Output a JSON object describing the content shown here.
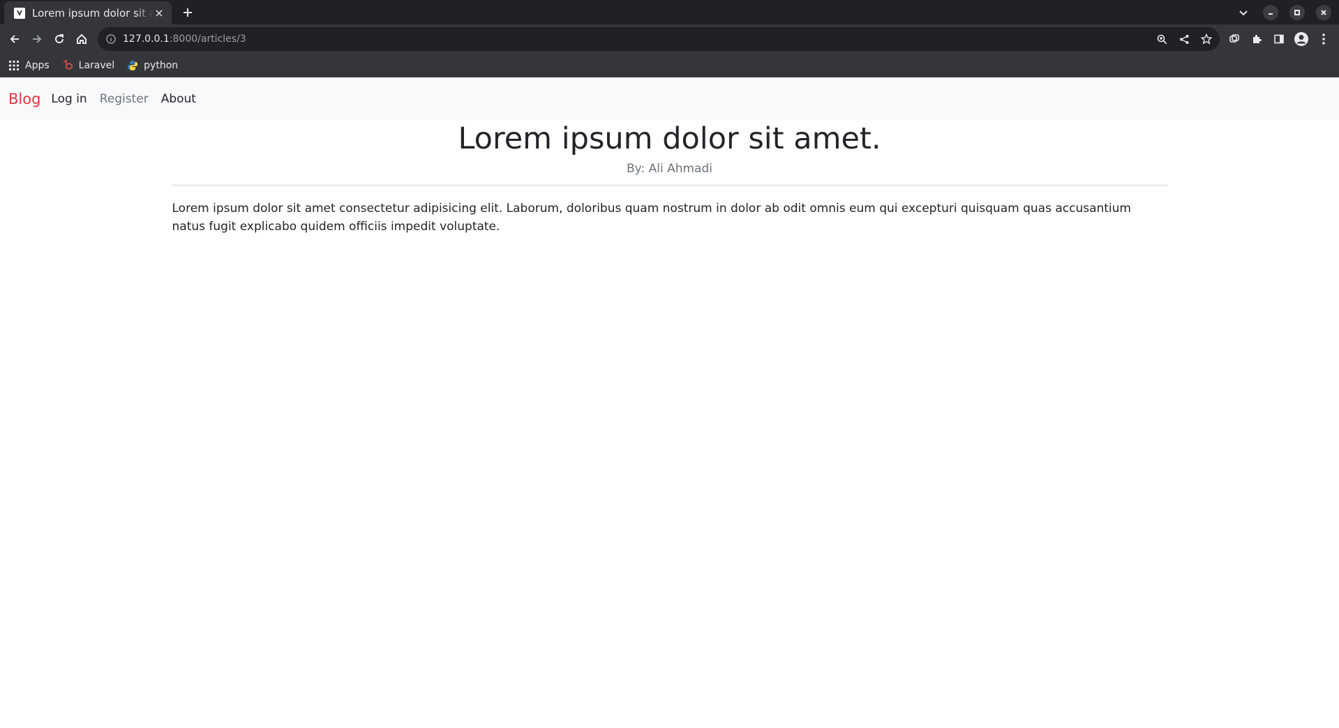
{
  "browser": {
    "tab_title": "Lorem ipsum dolor sit amet.",
    "url_host": "127.0.0.1",
    "url_path": ":8000/articles/3",
    "bookmarks": [
      {
        "label": "Apps",
        "icon": "apps-grid-icon"
      },
      {
        "label": "Laravel",
        "icon": "laravel-icon"
      },
      {
        "label": "python",
        "icon": "python-icon"
      }
    ]
  },
  "nav": {
    "brand": "Blog",
    "links": [
      {
        "label": "Log in"
      },
      {
        "label": "Register"
      },
      {
        "label": "About"
      }
    ]
  },
  "article": {
    "title": "Lorem ipsum dolor sit amet.",
    "author": "By: Ali Ahmadi",
    "body": "Lorem ipsum dolor sit amet consectetur adipisicing elit. Laborum, doloribus quam nostrum in dolor ab odit omnis eum qui excepturi quisquam quas accusantium natus fugit explicabo quidem officiis impedit voluptate."
  },
  "colors": {
    "brand": "#dc3545",
    "navbar_bg": "#f8f9fa",
    "chrome_dark": "#202124",
    "chrome_toolbar": "#35363a"
  }
}
